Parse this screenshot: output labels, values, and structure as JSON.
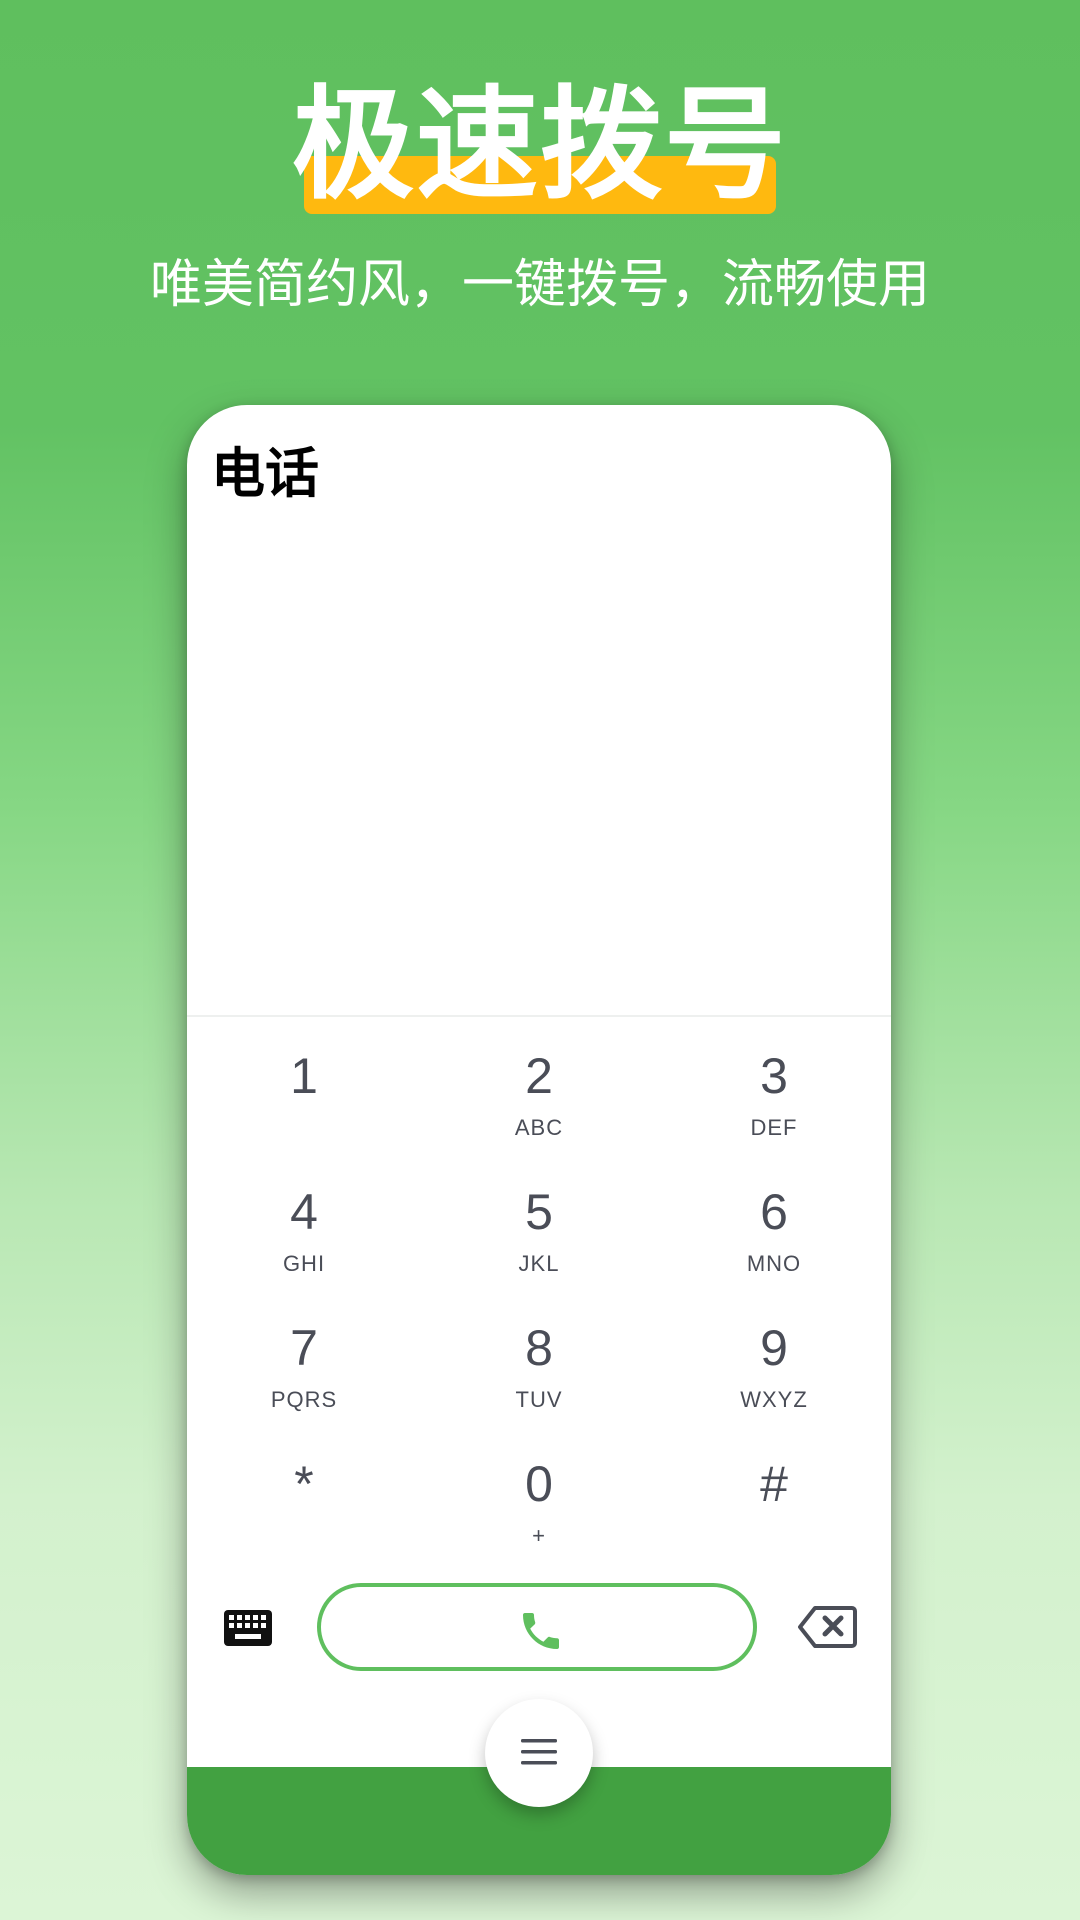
{
  "promo": {
    "title": "极速拨号",
    "subtitle": "唯美简约风，一键拨号，流畅使用"
  },
  "phone": {
    "screen_title": "电话",
    "keypad": [
      {
        "digit": "1",
        "letters": ""
      },
      {
        "digit": "2",
        "letters": "ABC"
      },
      {
        "digit": "3",
        "letters": "DEF"
      },
      {
        "digit": "4",
        "letters": "GHI"
      },
      {
        "digit": "5",
        "letters": "JKL"
      },
      {
        "digit": "6",
        "letters": "MNO"
      },
      {
        "digit": "7",
        "letters": "PQRS"
      },
      {
        "digit": "8",
        "letters": "TUV"
      },
      {
        "digit": "9",
        "letters": "WXYZ"
      },
      {
        "digit": "*",
        "letters": ""
      },
      {
        "digit": "0",
        "letters": "+"
      },
      {
        "digit": "#",
        "letters": ""
      }
    ],
    "icons": {
      "keyboard": "keyboard-icon",
      "call": "phone-icon",
      "delete": "backspace-icon",
      "menu": "menu-icon"
    }
  },
  "colors": {
    "accent_green": "#5fbf5e",
    "bottom_bar_green": "#42a141",
    "highlight_yellow": "#ffb90f",
    "key_text": "#4a4d57"
  }
}
